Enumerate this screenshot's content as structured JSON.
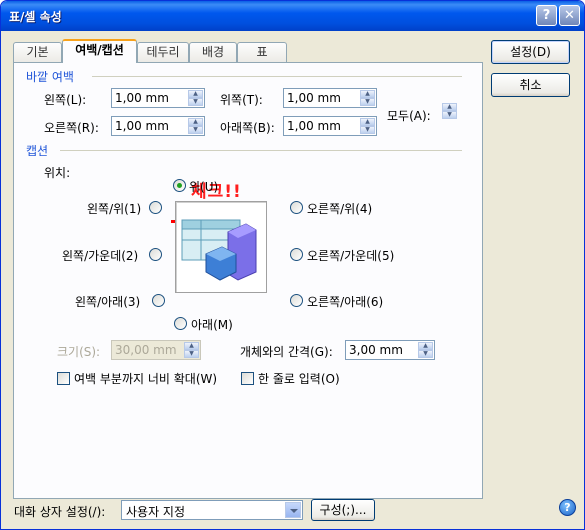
{
  "window": {
    "title": "표/셀 속성"
  },
  "tabs": [
    {
      "label": "기본"
    },
    {
      "label": "여백/캡션"
    },
    {
      "label": "테두리"
    },
    {
      "label": "배경"
    },
    {
      "label": "표"
    }
  ],
  "outer_margin": {
    "group_label": "바깥 여백",
    "left_label": "왼쪽(L):",
    "left_value": "1,00 mm",
    "top_label": "위쪽(T):",
    "top_value": "1,00 mm",
    "right_label": "오른쪽(R):",
    "right_value": "1,00 mm",
    "bottom_label": "아래쪽(B):",
    "bottom_value": "1,00 mm",
    "all_label": "모두(A):"
  },
  "caption": {
    "group_label": "캡션",
    "position_label": "위치:",
    "options": {
      "top": "위(U)",
      "left_top": "왼쪽/위(1)",
      "right_top": "오른쪽/위(4)",
      "left_middle": "왼쪽/가운데(2)",
      "right_middle": "오른쪽/가운데(5)",
      "left_bottom": "왼쪽/아래(3)",
      "right_bottom": "오른쪽/아래(6)",
      "bottom": "아래(M)"
    },
    "selected": "top",
    "size_label": "크기(S):",
    "size_value": "30,00 mm",
    "gap_label": "개체와의 간격(G):",
    "gap_value": "3,00 mm",
    "expand_label": "여백 부분까지 너비 확대(W)",
    "oneline_label": "한 줄로 입력(O)"
  },
  "annotation": {
    "text": "체크!!",
    "color": "#ff1e1e"
  },
  "buttons": {
    "ok": "설정(D)",
    "cancel": "취소",
    "config": "구성(;)..."
  },
  "footer": {
    "dialog_settings_label": "대화 상자 설정(/):",
    "dialog_settings_value": "사용자 지정"
  },
  "colors": {
    "titlebar": "#0054e3",
    "group_label": "#2156d8",
    "active_tab_accent": "#f7a21c"
  },
  "icons": {
    "help": "question-icon",
    "close": "close-icon",
    "footer_help": "help-icon"
  }
}
